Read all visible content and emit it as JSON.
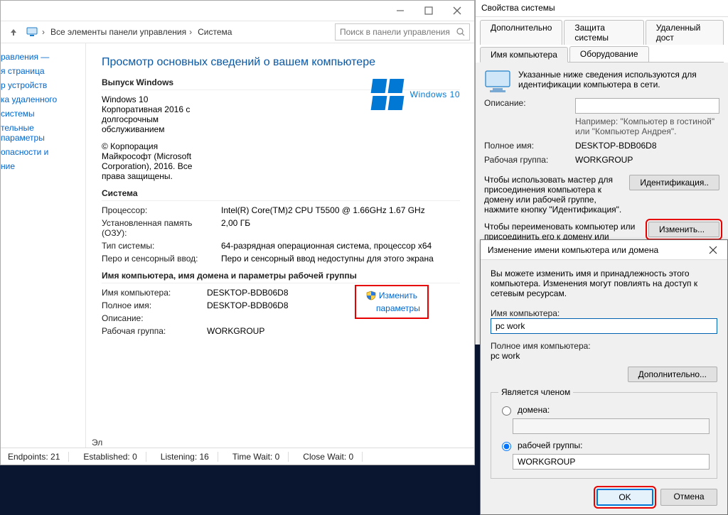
{
  "main_window": {
    "breadcrumb": {
      "root": "Все элементы панели управления",
      "leaf": "Система"
    },
    "search_placeholder": "Поиск в панели управления",
    "left_nav": {
      "home_frag1": "равления —",
      "home_frag2": "я страница",
      "devmgr": "р устройств",
      "remote": "ка удаленного",
      "protect": "системы",
      "advanced": "тельные параметры",
      "seealso1": "опасности и",
      "seealso2": "ние"
    },
    "title": "Просмотр основных сведений о вашем компьютере",
    "edition_head": "Выпуск Windows",
    "edition_lines": [
      "Windows 10",
      "Корпоративная 2016 с",
      "долгосрочным",
      "обслуживанием",
      "© Корпорация",
      "Майкрософт (Microsoft",
      "Corporation), 2016. Все",
      "права защищены."
    ],
    "brand_text": "Windows 10",
    "system_head": "Система",
    "sys_cpu_label": "Процессор:",
    "sys_cpu_value": "Intel(R) Core(TM)2 CPU       T5500  @ 1.66GHz   1.67 GHz",
    "sys_ram_label": "Установленная память (ОЗУ):",
    "sys_ram_value": "2,00 ГБ",
    "sys_type_label": "Тип системы:",
    "sys_type_value": "64-разрядная операционная система, процессор x64",
    "sys_touch_label": "Перо и сенсорный ввод:",
    "sys_touch_value": "Перо и сенсорный ввод недоступны для этого экрана",
    "domain_head": "Имя компьютера, имя домена и параметры рабочей группы",
    "cname_label": "Имя компьютера:",
    "cname_value": "DESKTOP-BDB06D8",
    "fqdn_label": "Полное имя:",
    "fqdn_value": "DESKTOP-BDB06D8",
    "desc_label": "Описание:",
    "wg_label": "Рабочая группа:",
    "wg_value": "WORKGROUP",
    "change_link1": "Изменить",
    "change_link2": "параметры",
    "status": {
      "el": "Эл",
      "endpoints": "Endpoints: 21",
      "established": "Established: 0",
      "listening": "Listening: 16",
      "timewait": "Time Wait: 0",
      "closewait": "Close Wait: 0"
    }
  },
  "props_window": {
    "title": "Свойства системы",
    "tabs_row1": {
      "advanced": "Дополнительно",
      "protect": "Защита системы",
      "remote": "Удаленный дост"
    },
    "tabs_row2": {
      "name": "Имя компьютера",
      "hardware": "Оборудование"
    },
    "info_text": "Указанные ниже сведения используются для идентификации компьютера в сети.",
    "desc_label": "Описание:",
    "example": "Например: \"Компьютер в гостиной\" или \"Компьютер Андрея\".",
    "fqdn_label": "Полное имя:",
    "fqdn_value": "DESKTOP-BDB06D8",
    "wg_label": "Рабочая группа:",
    "wg_value": "WORKGROUP",
    "ident_help": "Чтобы использовать мастер для присоединения компьютера к домену или рабочей группе, нажмите кнопку \"Идентификация\".",
    "ident_btn": "Идентификация..",
    "change_help": "Чтобы переименовать компьютер или присоединить его к домену или рабочей",
    "change_btn": "Изменить..."
  },
  "rename_dialog": {
    "title": "Изменение имени компьютера или домена",
    "lead": "Вы можете изменить имя и принадлежность этого компьютера. Изменения могут повлиять на доступ к сетевым ресурсам.",
    "name_label": "Имя компьютера:",
    "name_value": "pc work",
    "fqdn_label": "Полное имя компьютера:",
    "fqdn_value": "pc work",
    "more_btn": "Дополнительно...",
    "member_head": "Является членом",
    "domain_radio": "домена:",
    "workgroup_radio": "рабочей группы:",
    "workgroup_value": "WORKGROUP",
    "ok": "OK",
    "cancel": "Отмена"
  }
}
